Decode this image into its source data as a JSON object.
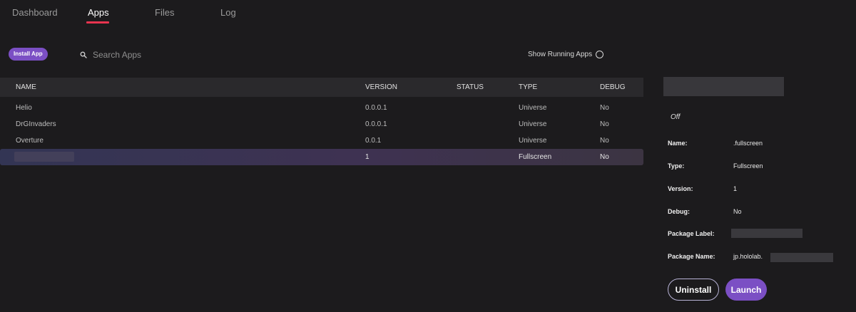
{
  "nav": {
    "tabs": [
      {
        "label": "Dashboard",
        "active": false
      },
      {
        "label": "Apps",
        "active": true
      },
      {
        "label": "Files",
        "active": false
      },
      {
        "label": "Log",
        "active": false
      }
    ],
    "accent_color": "#e8344f"
  },
  "toolbar": {
    "install_label": "Install App",
    "search_placeholder": "Search Apps",
    "search_icon": "search-icon",
    "show_running_label": "Show Running Apps",
    "show_running_checked": false
  },
  "table": {
    "columns": [
      "NAME",
      "VERSION",
      "STATUS",
      "TYPE",
      "DEBUG"
    ],
    "rows": [
      {
        "name": "Helio",
        "version": "0.0.0.1",
        "status": "",
        "type": "Universe",
        "debug": "No",
        "selected": false
      },
      {
        "name": "DrGInvaders",
        "version": "0.0.0.1",
        "status": "",
        "type": "Universe",
        "debug": "No",
        "selected": false
      },
      {
        "name": "Overture",
        "version": "0.0.1",
        "status": "",
        "type": "Universe",
        "debug": "No",
        "selected": false
      },
      {
        "name": "",
        "version": "1",
        "status": "",
        "type": "Fullscreen",
        "debug": "No",
        "selected": true
      }
    ]
  },
  "details": {
    "state": "Off",
    "fields": [
      {
        "label": "Name:",
        "value": ".fullscreen"
      },
      {
        "label": "Type:",
        "value": "Fullscreen"
      },
      {
        "label": "Version:",
        "value": "1"
      },
      {
        "label": "Debug:",
        "value": "No"
      },
      {
        "label": "Package Label:",
        "value": ""
      },
      {
        "label": "Package Name:",
        "value": "jp.hololab."
      }
    ],
    "uninstall_label": "Uninstall",
    "launch_label": "Launch",
    "brand_color": "#7b4fc4"
  }
}
